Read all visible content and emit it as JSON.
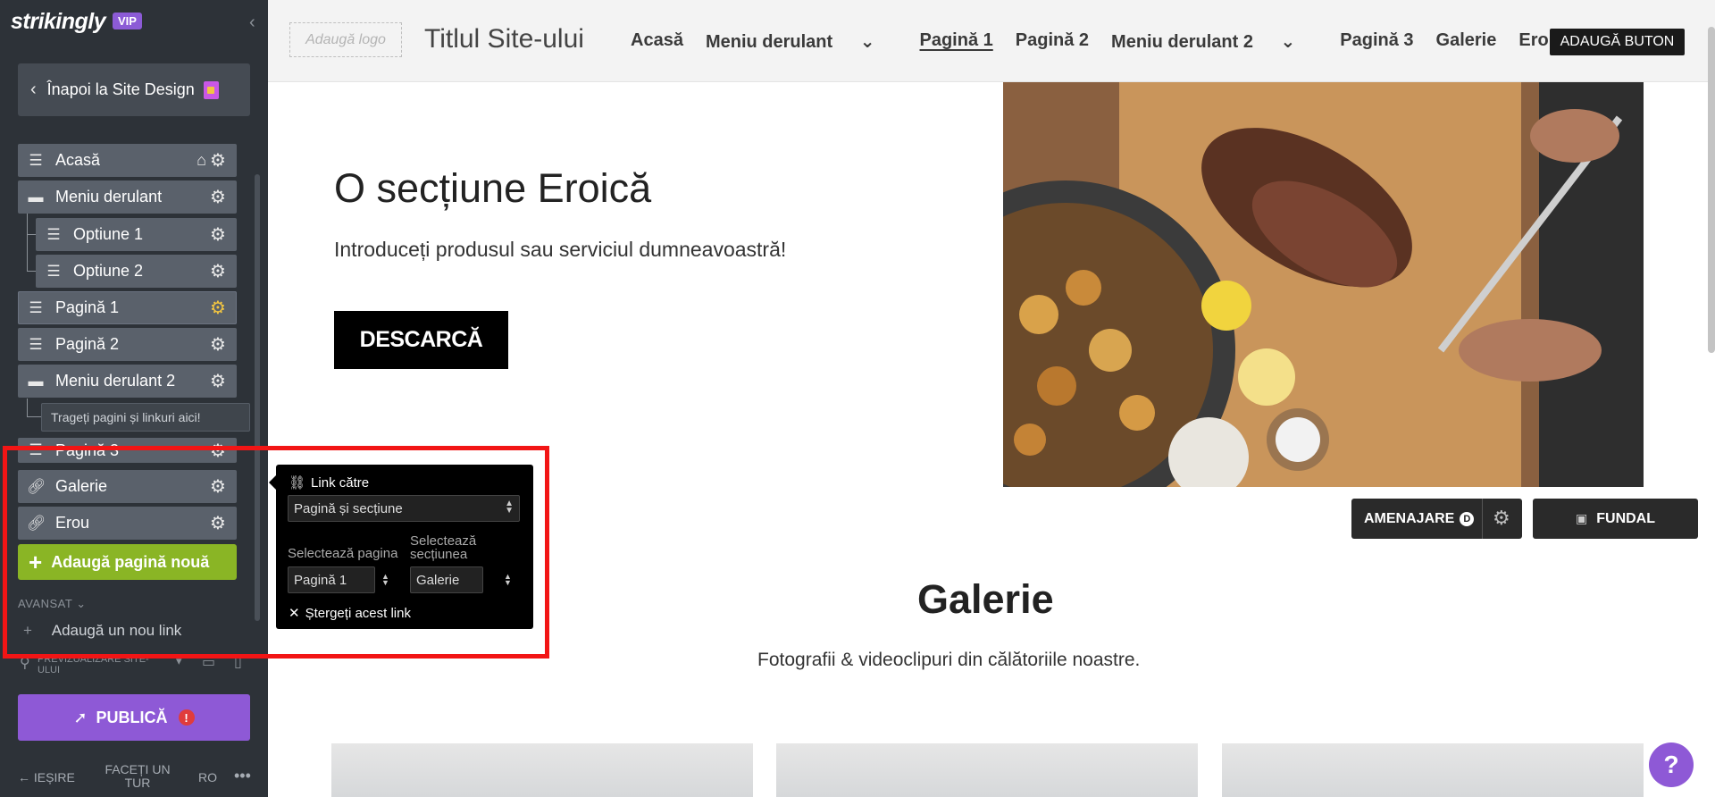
{
  "sidebar": {
    "logo": "strikingly",
    "vip_badge": "VIP",
    "back_label": "Înapoi la Site Design",
    "items": [
      {
        "label": "Acasă",
        "icon": "menu-icon"
      },
      {
        "label": "Meniu derulant",
        "icon": "folder-icon"
      },
      {
        "label": "Optiune 1",
        "icon": "menu-icon"
      },
      {
        "label": "Optiune 2",
        "icon": "menu-icon"
      },
      {
        "label": "Pagină 1",
        "icon": "menu-icon"
      },
      {
        "label": "Pagină 2",
        "icon": "menu-icon"
      },
      {
        "label": "Meniu derulant 2",
        "icon": "folder-icon"
      },
      {
        "label": "Pagină 3",
        "icon": "menu-icon"
      },
      {
        "label": "Galerie",
        "icon": "link-icon"
      },
      {
        "label": "Erou",
        "icon": "link-icon"
      }
    ],
    "drop_hint": "Trageți pagini și linkuri aici!",
    "add_page": "Adaugă pagină nouă",
    "advanced": "AVANSAT",
    "add_link": "Adaugă un nou link",
    "preview": "PREVIZUALIZARE SITE-ULUI",
    "publish": "PUBLICĂ",
    "footer": {
      "exit": "IEȘIRE",
      "tour": "FACEȚI UN TUR",
      "lang": "RO"
    },
    "active_gear_color": "#f2c541"
  },
  "topbar": {
    "logo_placeholder": "Adaugă logo",
    "site_title": "Titlul Site-ului",
    "menu": [
      "Acasă",
      "Meniu derulant",
      "Pagină 1",
      "Pagină 2",
      "Meniu derulant 2",
      "Pagină 3",
      "Galerie",
      "Erou"
    ],
    "current_menu": "Pagină 1",
    "add_button": "ADAUGĂ BUTON"
  },
  "hero": {
    "title": "O secțiune Eroică",
    "subtitle": "Introduceți produsul sau serviciul dumneavoastră!",
    "cta": "DESCARCĂ"
  },
  "section_controls": {
    "arrange": "AMENAJARE",
    "arrange_badge": "D",
    "background": "FUNDAL"
  },
  "gallery": {
    "title": "Galerie",
    "subtitle": "Fotografii & videoclipuri din călătoriile noastre."
  },
  "popover": {
    "title": "Link către",
    "link_type": "Pagină și secțiune",
    "page_label": "Selectează pagina",
    "section_label": "Selectează secțiunea",
    "page_value": "Pagină 1",
    "section_value": "Galerie",
    "remove": "Ștergeți acest link"
  },
  "colors": {
    "sidebar_bg": "#2d3238",
    "accent_purple": "#8e59d6",
    "add_green": "#8ab525",
    "highlight_red": "#f21515"
  }
}
